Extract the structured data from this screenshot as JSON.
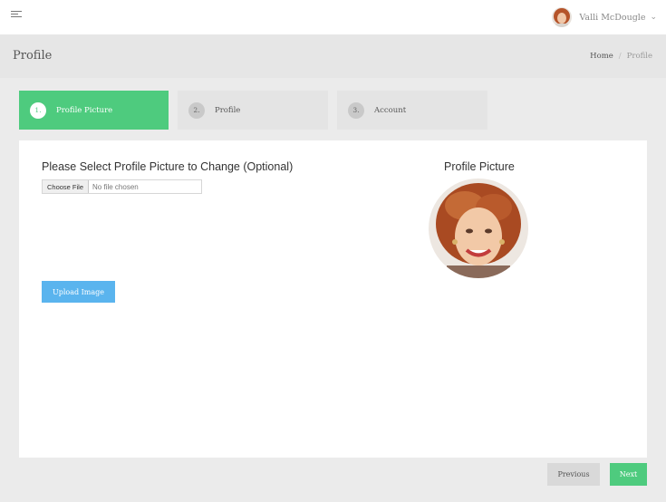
{
  "topbar": {
    "menu_icon": "hamburger-menu-icon",
    "user": {
      "name": "Valli McDougle",
      "avatar_icon": "user-avatar-icon",
      "caret_icon": "chevron-down-icon"
    }
  },
  "page_header": {
    "title": "Profile",
    "breadcrumb": {
      "home": "Home",
      "separator": "/",
      "current": "Profile"
    }
  },
  "wizard": {
    "steps": [
      {
        "number": "1.",
        "label": "Profile Picture",
        "active": true
      },
      {
        "number": "2.",
        "label": "Profile",
        "active": false
      },
      {
        "number": "3.",
        "label": "Account",
        "active": false
      }
    ]
  },
  "panel": {
    "select_label": "Please Select Profile Picture to Change (Optional)",
    "file_input": {
      "button_label": "Choose File",
      "status_text": "No file chosen"
    },
    "upload_button": "Upload Image",
    "picture_title": "Profile Picture"
  },
  "footer": {
    "previous_label": "Previous",
    "next_label": "Next"
  },
  "colors": {
    "accent_green": "#4ecb7e",
    "upload_blue": "#5ab4ee",
    "background": "#ebebeb",
    "header_gray": "#e6e6e6"
  }
}
